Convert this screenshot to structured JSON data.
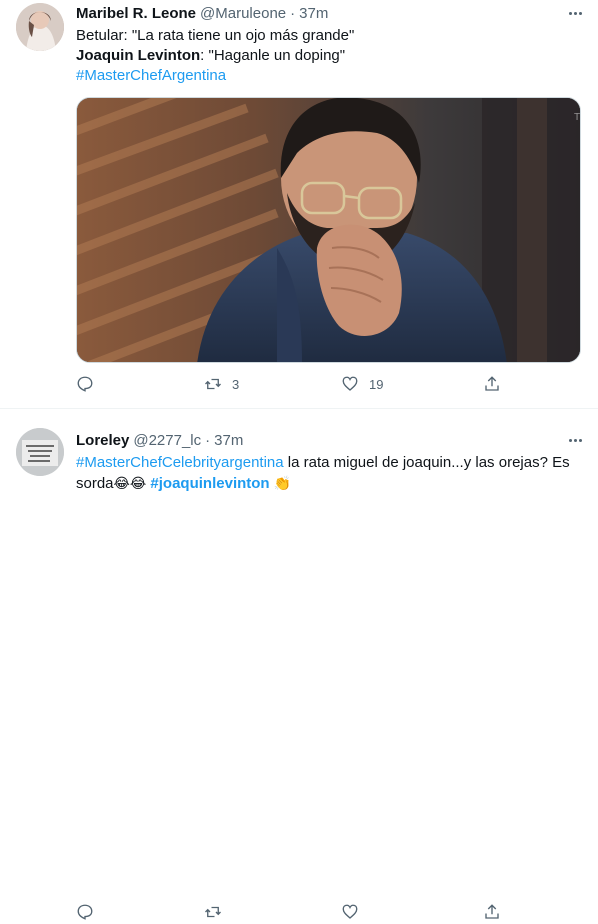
{
  "tweets": [
    {
      "name": "Maribel R. Leone",
      "handle": "@Maruleone",
      "separator": "·",
      "time": "37m",
      "lines": [
        {
          "prefix": "",
          "text": "Betular: \"La rata tiene un ojo más grande\""
        },
        {
          "prefix": "Joaquin Levinton",
          "text": ": \"Haganle un doping\""
        }
      ],
      "hashtag": "#MasterChefArgentina",
      "actions": {
        "reply_count": "",
        "retweet_count": "3",
        "like_count": "19"
      }
    },
    {
      "name": "Loreley",
      "handle": "@2277_lc",
      "separator": "·",
      "time": "37m",
      "hashtag": "#MasterChefCelebrityargentina",
      "text_after_hashtag": " la rata miguel de joaquin...y las orejas? Es",
      "text_line2": "sorda",
      "emoji_laugh": "😂😂",
      "hashtag2": "#joaquinlevinton",
      "emoji_clap": "👏",
      "actions": {
        "reply_count": "",
        "retweet_count": "",
        "like_count": ""
      }
    }
  ],
  "icons": {
    "reply": "reply-icon",
    "retweet": "retweet-icon",
    "like": "heart-icon",
    "share": "share-icon",
    "more": "more-icon"
  },
  "colors": {
    "link": "#1d9bf0",
    "secondary": "#536471",
    "text": "#0f1419"
  }
}
